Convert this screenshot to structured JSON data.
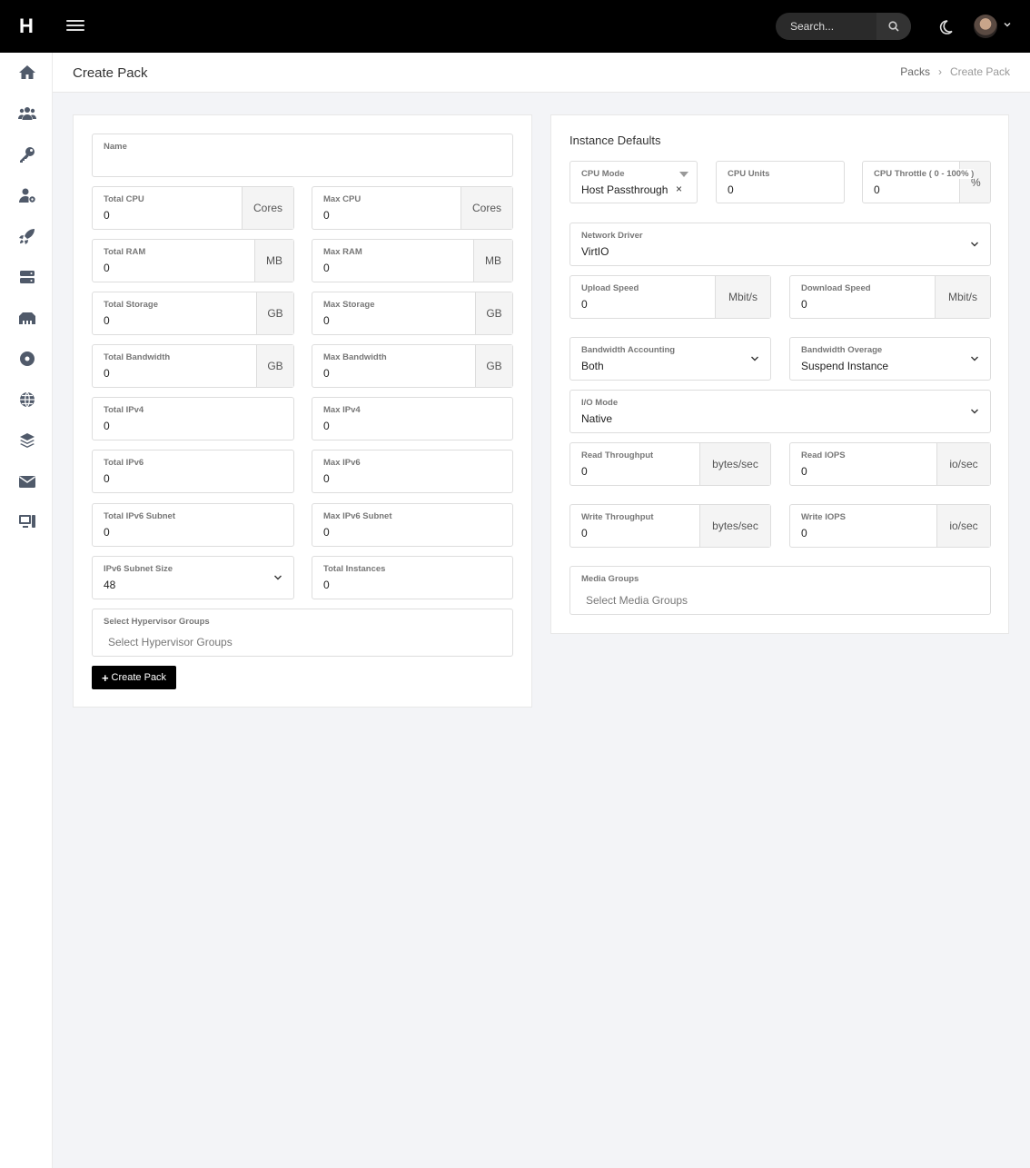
{
  "app": {
    "logo": "H"
  },
  "topbar": {
    "search_placeholder": "Search..."
  },
  "nav_icons": [
    "home-icon",
    "users-icon",
    "key-icon",
    "user-settings-icon",
    "rocket-icon",
    "server-icon",
    "network-icon",
    "disc-icon",
    "globe-icon",
    "layers-icon",
    "mail-icon",
    "desktop-icon"
  ],
  "header": {
    "title": "Create Pack",
    "breadcrumb": [
      "Packs",
      "Create Pack"
    ]
  },
  "left_form": {
    "name": {
      "label": "Name",
      "value": ""
    },
    "total_cpu": {
      "label": "Total CPU",
      "value": "0",
      "unit": "Cores"
    },
    "max_cpu": {
      "label": "Max CPU",
      "value": "0",
      "unit": "Cores"
    },
    "total_ram": {
      "label": "Total RAM",
      "value": "0",
      "unit": "MB"
    },
    "max_ram": {
      "label": "Max RAM",
      "value": "0",
      "unit": "MB"
    },
    "total_storage": {
      "label": "Total Storage",
      "value": "0",
      "unit": "GB"
    },
    "max_storage": {
      "label": "Max Storage",
      "value": "0",
      "unit": "GB"
    },
    "total_bandwidth": {
      "label": "Total Bandwidth",
      "value": "0",
      "unit": "GB"
    },
    "max_bandwidth": {
      "label": "Max Bandwidth",
      "value": "0",
      "unit": "GB"
    },
    "total_ipv4": {
      "label": "Total IPv4",
      "value": "0"
    },
    "max_ipv4": {
      "label": "Max IPv4",
      "value": "0"
    },
    "total_ipv6": {
      "label": "Total IPv6",
      "value": "0"
    },
    "max_ipv6": {
      "label": "Max IPv6",
      "value": "0"
    },
    "total_ipv6_subnet": {
      "label": "Total IPv6 Subnet",
      "value": "0"
    },
    "max_ipv6_subnet": {
      "label": "Max IPv6 Subnet",
      "value": "0"
    },
    "ipv6_subnet_size": {
      "label": "IPv6 Subnet Size",
      "value": "48"
    },
    "total_instances": {
      "label": "Total Instances",
      "value": "0"
    },
    "hypervisor_groups": {
      "label": "Select Hypervisor Groups",
      "placeholder": "Select Hypervisor Groups"
    },
    "submit_label": "Create Pack"
  },
  "instance_defaults": {
    "title": "Instance Defaults",
    "cpu_mode": {
      "label": "CPU Mode",
      "value": "Host Passthrough",
      "clear": "×"
    },
    "cpu_units": {
      "label": "CPU Units",
      "value": "0"
    },
    "cpu_throttle": {
      "label": "CPU Throttle ( 0 - 100% )",
      "value": "0",
      "unit": "%"
    },
    "network_driver": {
      "label": "Network Driver",
      "value": "VirtIO"
    },
    "upload_speed": {
      "label": "Upload Speed",
      "value": "0",
      "unit": "Mbit/s"
    },
    "download_speed": {
      "label": "Download Speed",
      "value": "0",
      "unit": "Mbit/s"
    },
    "bandwidth_accounting": {
      "label": "Bandwidth Accounting",
      "value": "Both"
    },
    "bandwidth_overage": {
      "label": "Bandwidth Overage",
      "value": "Suspend Instance"
    },
    "io_mode": {
      "label": "I/O Mode",
      "value": "Native"
    },
    "read_throughput": {
      "label": "Read Throughput",
      "value": "0",
      "unit": "bytes/sec"
    },
    "read_iops": {
      "label": "Read IOPS",
      "value": "0",
      "unit": "io/sec"
    },
    "write_throughput": {
      "label": "Write Throughput",
      "value": "0",
      "unit": "bytes/sec"
    },
    "write_iops": {
      "label": "Write IOPS",
      "value": "0",
      "unit": "io/sec"
    },
    "media_groups": {
      "label": "Media Groups",
      "placeholder": "Select Media Groups"
    }
  }
}
